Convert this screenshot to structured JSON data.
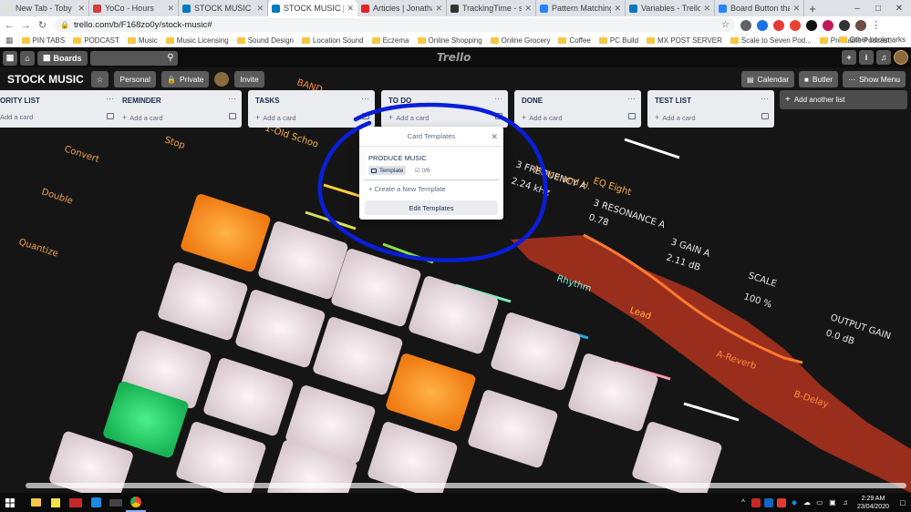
{
  "browser": {
    "tabs": [
      {
        "label": "New Tab - Toby",
        "favicon_color": "#e0e0e0",
        "active": false
      },
      {
        "label": "YoCo - Hours",
        "favicon_color": "#d63c3c",
        "active": false
      },
      {
        "label": "STOCK MUSIC | Trello",
        "favicon_color": "#0079bf",
        "active": false
      },
      {
        "label": "STOCK MUSIC | Trello",
        "favicon_color": "#0079bf",
        "active": true
      },
      {
        "label": "Articles | Jonathan Wri...",
        "favicon_color": "#e02424",
        "active": false
      },
      {
        "label": "TrackingTime - stoppe...",
        "favicon_color": "#333333",
        "active": false
      },
      {
        "label": "Pattern Matching and ...",
        "favicon_color": "#2684ff",
        "active": false
      },
      {
        "label": "Variables - Trello Help",
        "favicon_color": "#0079bf",
        "active": false
      },
      {
        "label": "Board Button that Cre...",
        "favicon_color": "#2684ff",
        "active": false
      }
    ],
    "url": "trello.com/b/F168zo0y/stock-music#",
    "bookmarks": [
      "PIN TABS",
      "PODCAST",
      "Music",
      "Music Licensing",
      "Sound Design",
      "Location Sound",
      "Eczema",
      "Online Shopping",
      "Online Grocery",
      "Coffee",
      "PC Build",
      "MX POST SERVER",
      "Scale to Seven Pod...",
      "Profitable Podcast..."
    ],
    "other_bookmarks": "Other bookmarks"
  },
  "trello": {
    "header": {
      "boards_label": "Boards",
      "logo": "Trello"
    },
    "board": {
      "title": "STOCK MUSIC",
      "visibility_personal": "Personal",
      "visibility_private": "Private",
      "invite_label": "Invite",
      "calendar_label": "Calendar",
      "butler_label": "Butler",
      "show_menu_label": "Show Menu"
    },
    "lists": [
      {
        "title": "ORITY LIST",
        "add_card": "Add a card"
      },
      {
        "title": "REMINDER",
        "add_card": "Add a card"
      },
      {
        "title": "TASKS",
        "add_card": "Add a card"
      },
      {
        "title": "TO DO",
        "add_card": "Add a card"
      },
      {
        "title": "DONE",
        "add_card": "Add a card"
      },
      {
        "title": "TEST LIST",
        "add_card": "Add a card"
      }
    ],
    "add_another_list": "Add another list",
    "card_templates_popover": {
      "title": "Card Templates",
      "template_card": {
        "name": "PRODUCE MUSIC",
        "badge": "Template",
        "checklist": "0/6"
      },
      "create_new": "Create a New Template",
      "edit": "Edit Templates"
    }
  },
  "taskbar": {
    "time": "2:29 AM",
    "date": "23/04/2020"
  },
  "colors": {
    "annotation_circle": "#0a1ed8",
    "popover_bg": "#ffffff",
    "list_bg": "#ebecf0"
  }
}
